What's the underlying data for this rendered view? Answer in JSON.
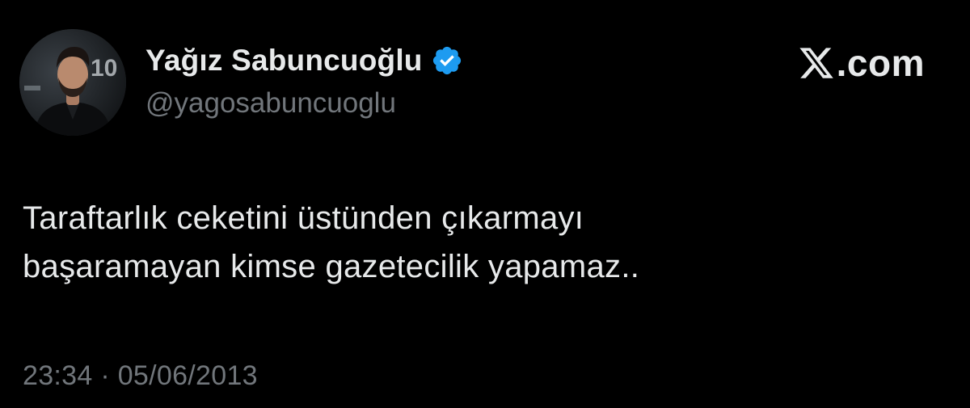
{
  "author": {
    "name": "Yağız Sabuncuoğlu",
    "handle": "@yagosabuncuoglu",
    "verified": true
  },
  "brand": {
    "domain": ".com",
    "icon": "x-logo-icon"
  },
  "tweet": {
    "text": "Taraftarlık ceketini üstünden çıkarmayı\nbaşaramayan kimse gazetecilik yapamaz..",
    "timestamp": "23:34 · 05/06/2013"
  },
  "colors": {
    "background": "#000000",
    "primary_text": "#e7e9ea",
    "secondary_text": "#71767b",
    "verified_badge": "#1d9bf0"
  }
}
